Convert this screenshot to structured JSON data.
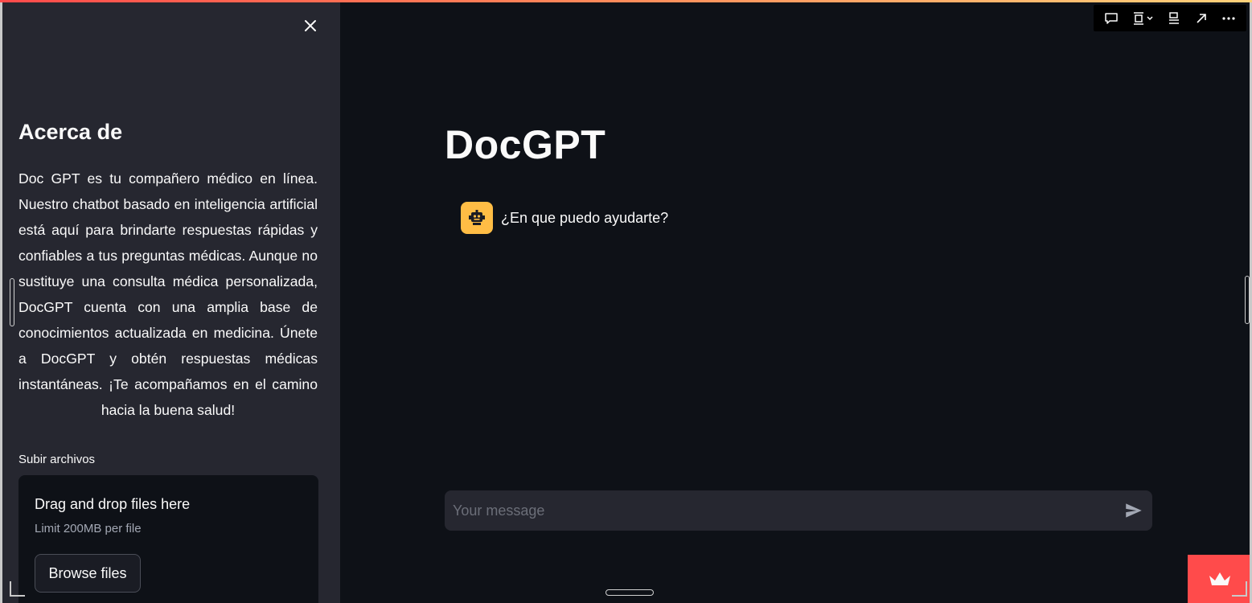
{
  "sidebar": {
    "heading": "Acerca de",
    "about_text": "Doc GPT es tu compañero médico en línea. Nuestro chatbot basado en inteligencia artificial está aquí para brindarte respuestas rápidas y confiables a tus preguntas médicas. Aunque no sustituye una consulta médica personalizada, DocGPT cuenta con una amplia base de conocimientos actualizada en medicina. Únete a DocGPT y obtén respuestas médicas instantáneas. ¡Te acompañamos en el camino hacia la buena salud!",
    "upload_label": "Subir archivos",
    "dropzone_title": "Drag and drop files here",
    "dropzone_limit": "Limit 200MB per file",
    "browse_label": "Browse files",
    "close_icon": "close-icon"
  },
  "main": {
    "title": "DocGPT",
    "messages": [
      {
        "role": "assistant",
        "avatar_icon": "robot-icon",
        "text": "¿En que puedo ayudarte?"
      }
    ],
    "chat_input": {
      "placeholder": "Your message",
      "value": ""
    },
    "send_icon": "send-icon"
  },
  "toolbar": {
    "icons": [
      "comment-icon",
      "layout-icon",
      "chevron-down-icon",
      "align-icon",
      "open-external-icon",
      "more-icon"
    ]
  },
  "colors": {
    "sidebar_bg": "#262730",
    "main_bg": "#0e1117",
    "accent": "#ff4b4b",
    "avatar": "#ffbd45"
  }
}
